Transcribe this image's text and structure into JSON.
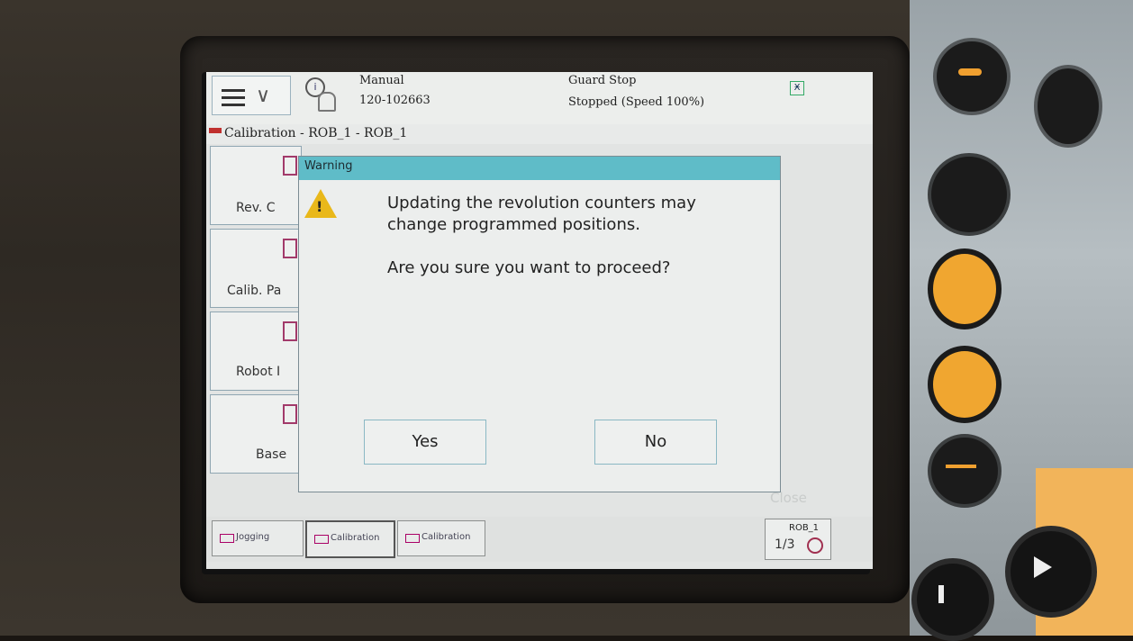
{
  "header": {
    "mode": "Manual",
    "controller_id": "120-102663",
    "status_title": "Guard Stop",
    "status_detail": "Stopped (Speed 100%)"
  },
  "breadcrumb": "Calibration - ROB_1 - ROB_1",
  "nav": {
    "items": [
      {
        "label": "Rev. C"
      },
      {
        "label": "Calib. Pa"
      },
      {
        "label": "Robot I"
      },
      {
        "label": "Base"
      }
    ]
  },
  "dialog": {
    "title": "Warning",
    "message_line1": "Updating the revolution counters may",
    "message_line2": "change programmed positions.",
    "question": "Are you sure you want to proceed?",
    "yes_label": "Yes",
    "no_label": "No"
  },
  "close_label": "Close",
  "taskbar": {
    "tabs": [
      {
        "label": "Jogging"
      },
      {
        "label": "Calibration"
      },
      {
        "label": "Calibration"
      }
    ],
    "robot": "ROB_1",
    "fraction": "1/3"
  }
}
